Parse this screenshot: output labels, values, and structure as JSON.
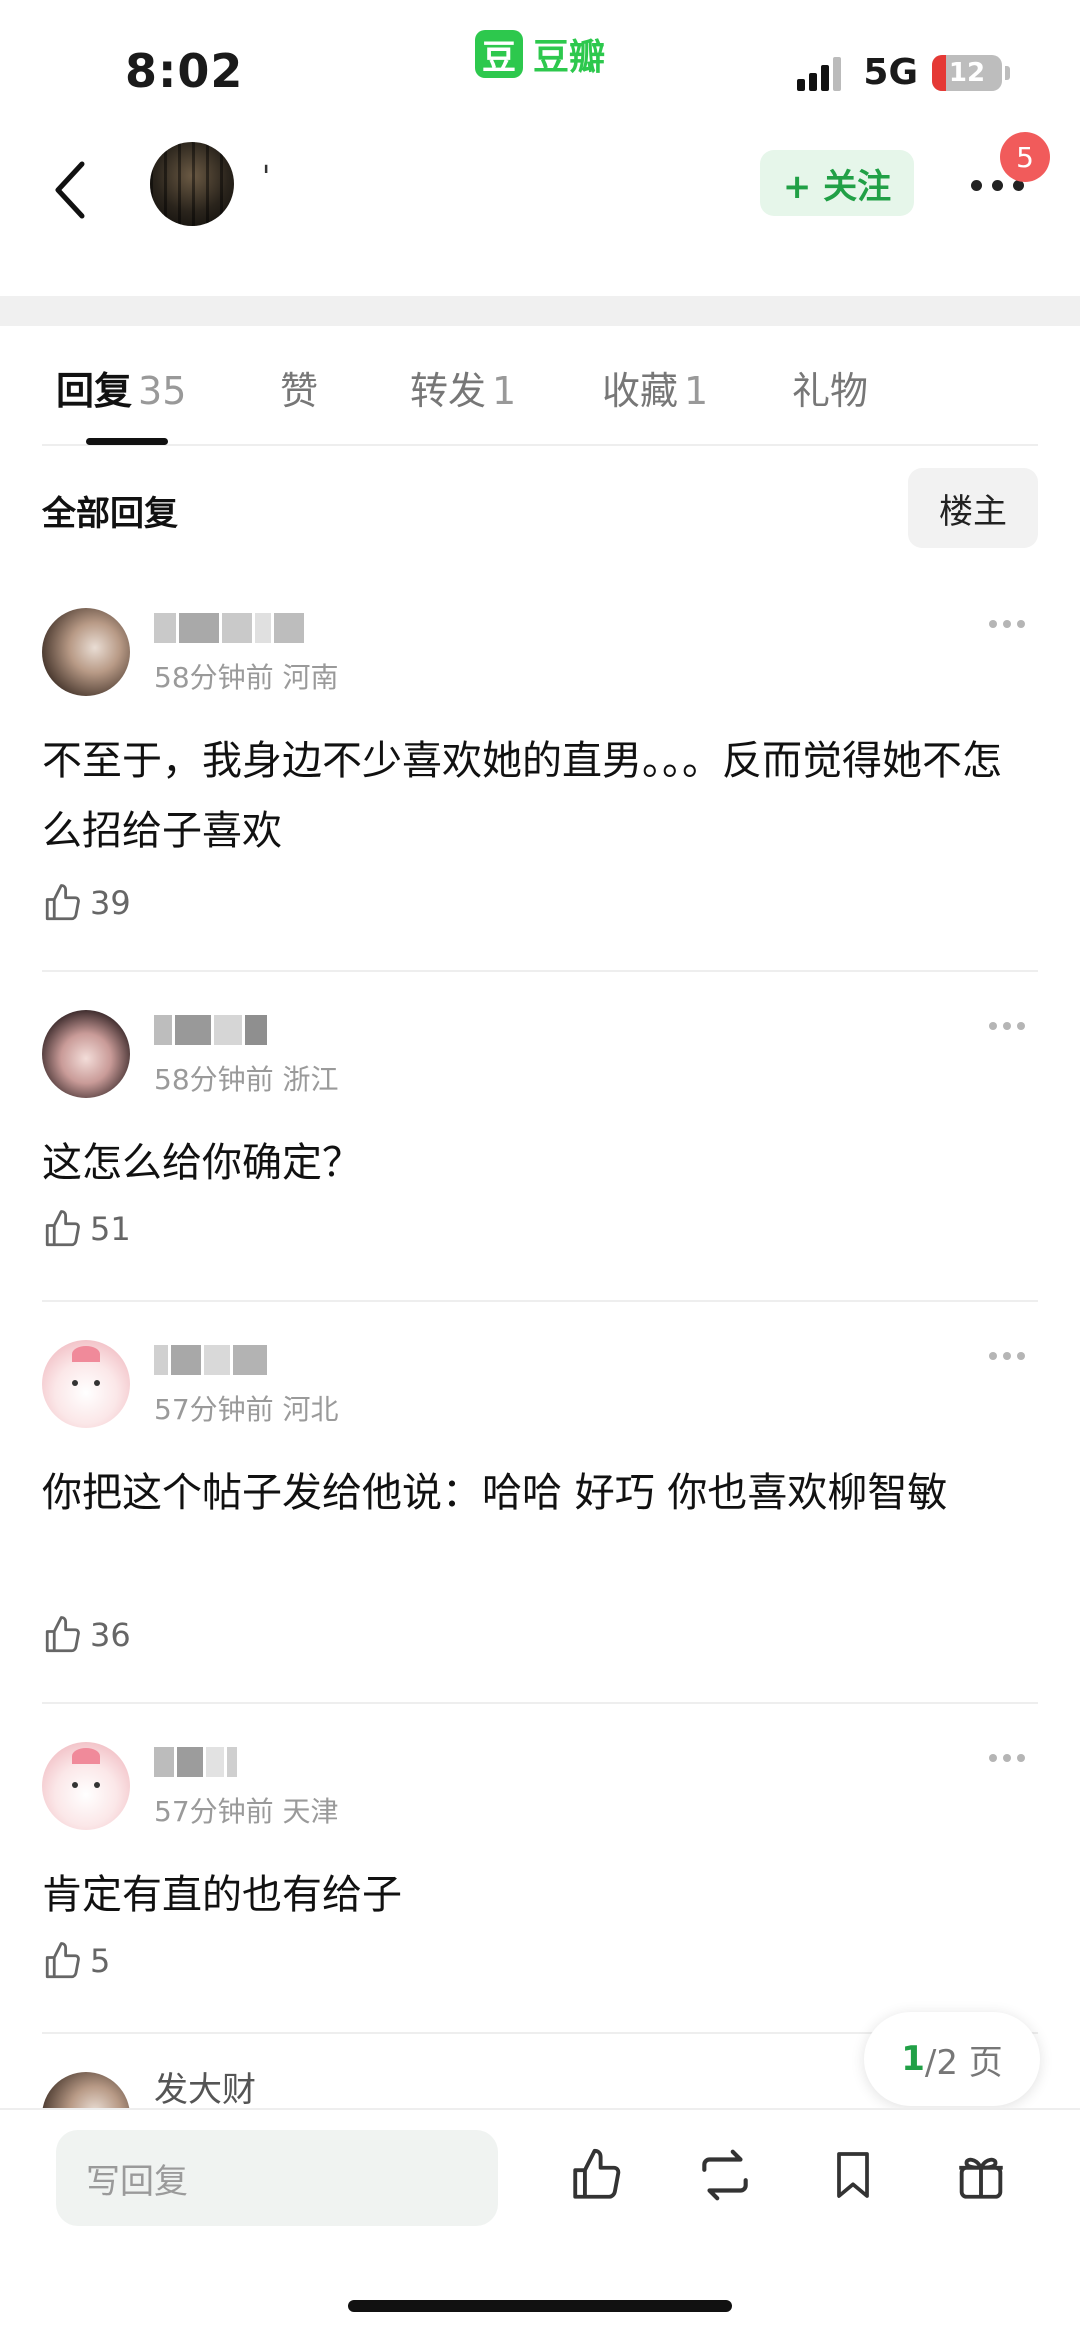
{
  "status_bar": {
    "time": "8:02",
    "app_badge": "豆",
    "app_name": "豆瓣",
    "network": "5G",
    "battery": "12"
  },
  "header": {
    "author_name": "'",
    "follow_label": "+ 关注",
    "notification_count": "5"
  },
  "tabs": [
    {
      "label": "回复",
      "count": "35",
      "active": true
    },
    {
      "label": "赞",
      "count": ""
    },
    {
      "label": "转发",
      "count": "1"
    },
    {
      "label": "收藏",
      "count": "1"
    },
    {
      "label": "礼物",
      "count": ""
    }
  ],
  "section": {
    "title": "全部回复",
    "filter_label": "楼主"
  },
  "comments": [
    {
      "time": "58分钟前",
      "location": "河南",
      "text": "不至于，我身边不少喜欢她的直男。。。反而觉得她不怎么招给子喜欢",
      "likes": "39"
    },
    {
      "time": "58分钟前",
      "location": "浙江",
      "text": "这怎么给你确定？",
      "likes": "51"
    },
    {
      "time": "57分钟前",
      "location": "河北",
      "text": "你把这个帖子发给他说：哈哈 好巧 你也喜欢柳智敏",
      "likes": "36"
    },
    {
      "time": "57分钟前",
      "location": "天津",
      "text": "肯定有直的也有给子",
      "likes": "5"
    },
    {
      "name": "发大财"
    }
  ],
  "pagination": {
    "current": "1",
    "total_text": "/2 页"
  },
  "bottom_bar": {
    "reply_placeholder": "写回复"
  }
}
